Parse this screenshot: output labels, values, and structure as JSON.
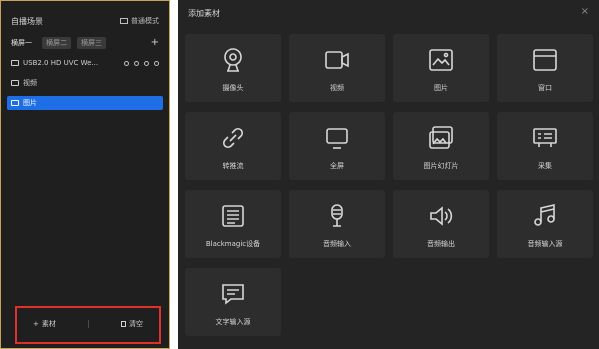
{
  "left_panel": {
    "title": "自播场景",
    "mode_label": "普通模式",
    "tabs": [
      "横屏一",
      "横屏二",
      "横屏三"
    ],
    "sources": [
      {
        "label": "USB2.0 HD UVC We...",
        "selected": false
      },
      {
        "label": "视频",
        "selected": false
      },
      {
        "label": "图片",
        "selected": true
      }
    ],
    "bottom": {
      "add_label": "素材",
      "clear_label": "清空"
    }
  },
  "dialog": {
    "title": "添加素材",
    "close": "×",
    "items": [
      {
        "label": "摄像头",
        "icon": "webcam-icon"
      },
      {
        "label": "视频",
        "icon": "video-icon"
      },
      {
        "label": "图片",
        "icon": "image-icon"
      },
      {
        "label": "窗口",
        "icon": "window-icon"
      },
      {
        "label": "转推流",
        "icon": "link-icon"
      },
      {
        "label": "全屏",
        "icon": "monitor-icon"
      },
      {
        "label": "图片幻灯片",
        "icon": "slideshow-icon"
      },
      {
        "label": "采集",
        "icon": "capture-card-icon"
      },
      {
        "label": "Blackmagic设备",
        "icon": "device-list-icon"
      },
      {
        "label": "音频输入",
        "icon": "microphone-icon"
      },
      {
        "label": "音频输出",
        "icon": "speaker-icon"
      },
      {
        "label": "音频输入源",
        "icon": "music-note-icon"
      },
      {
        "label": "文字输入源",
        "icon": "text-message-icon"
      }
    ]
  },
  "colors": {
    "selected": "#1e6fe6",
    "highlight_border": "#e0302c",
    "panel_border": "#c9a25a"
  }
}
